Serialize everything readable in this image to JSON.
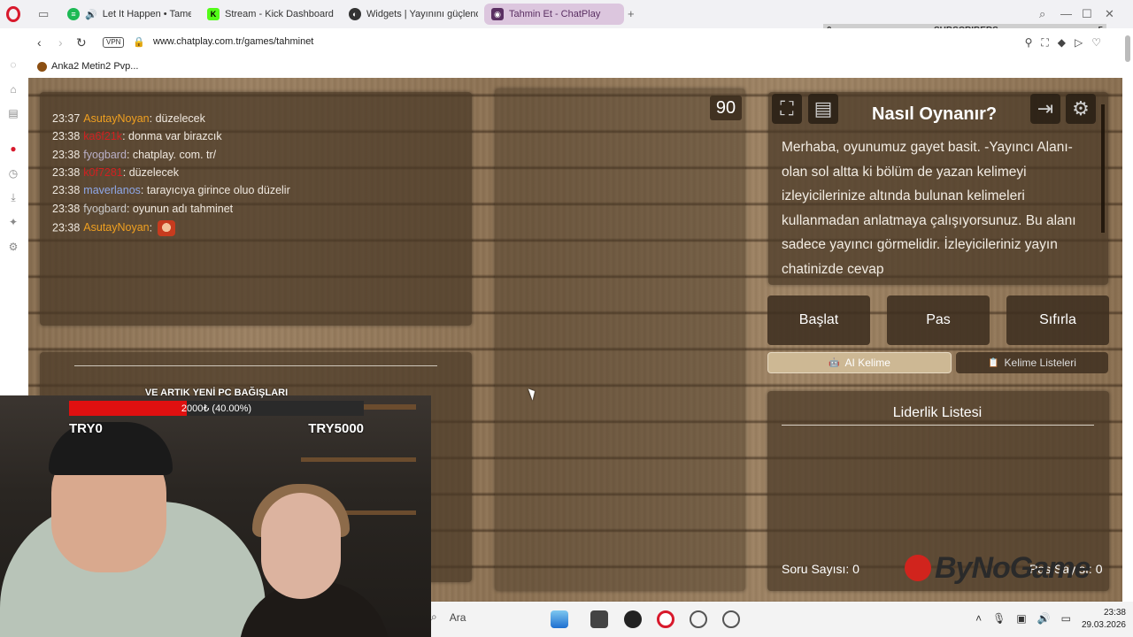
{
  "browser": {
    "tabs": [
      {
        "label": "Let It Happen • Tame I",
        "active": false
      },
      {
        "label": "Stream - Kick Dashboard",
        "active": false
      },
      {
        "label": "Widgets | Yayınını güçlend",
        "active": false
      },
      {
        "label": "Tahmin Et - ChatPlay",
        "active": true
      }
    ],
    "new_tab": "+",
    "subscribers": {
      "label": "SUBSCRIBERS",
      "min": "0",
      "max": "5"
    },
    "vpn": "VPN",
    "url": "www.chatplay.com.tr/games/tahminet",
    "bookmark": "Anka2 Metin2 Pvp..."
  },
  "chat": {
    "messages": [
      {
        "time": "23:37",
        "user": "AsutayNoyan",
        "color": "#f0a020",
        "text": ": düzelecek"
      },
      {
        "time": "23:38",
        "user": "ka6f21k",
        "color": "#d02020",
        "text": ": donma var birazcık"
      },
      {
        "time": "23:38",
        "user": "fyogbard",
        "color": "#b9b0c8",
        "text": ": chatplay. com. tr/"
      },
      {
        "time": "23:38",
        "user": "k0f7281",
        "color": "#d02020",
        "text": ": düzelecek"
      },
      {
        "time": "23:38",
        "user": "maverlanos",
        "color": "#8fa8e8",
        "text": ": tarayıcıya girince oluo düzelir"
      },
      {
        "time": "23:38",
        "user": "fyogbard",
        "color": "#c8c8c8",
        "text": ": oyunun adı tahminet"
      },
      {
        "time": "23:38",
        "user": "AsutayNoyan",
        "color": "#f0a020",
        "text": ":"
      }
    ]
  },
  "game": {
    "timer": "90",
    "howto_title": "Nasıl Oynanır?",
    "howto_text": "Merhaba, oyunumuz gayet basit. -Yayıncı Alanı- olan sol altta ki bölüm de yazan kelimeyi izleyicilerinize altında bulunan kelimeleri kullanmadan anlatmaya çalışıyorsunuz. Bu alanı sadece yayıncı görmelidir. İzleyicileriniz yayın chatinizde cevap",
    "buttons": {
      "start": "Başlat",
      "pass": "Pas",
      "reset": "Sıfırla"
    },
    "tabs": {
      "ai_word": "AI Kelime",
      "word_lists": "Kelime Listeleri"
    },
    "leaderboard_title": "Liderlik Listesi",
    "question_count": "Soru Sayısı: 0",
    "pass_count": "0",
    "pass_label": "Pas Sayısı: 0"
  },
  "donation": {
    "title": "VE ARTIK YENİ PC BAĞIŞLARI",
    "progress_text": "2000₺ (40.00%)",
    "progress": 0.4,
    "min": "TRY0",
    "max": "TRY5000"
  },
  "watermark": "ByNoGame",
  "taskbar": {
    "search": "Ara",
    "time": "23:38",
    "date": "29.03.2026"
  },
  "colors": {
    "accent_tab": "#dcc6de",
    "donation_bar": "#e01010",
    "opera_red": "#d8192c"
  }
}
